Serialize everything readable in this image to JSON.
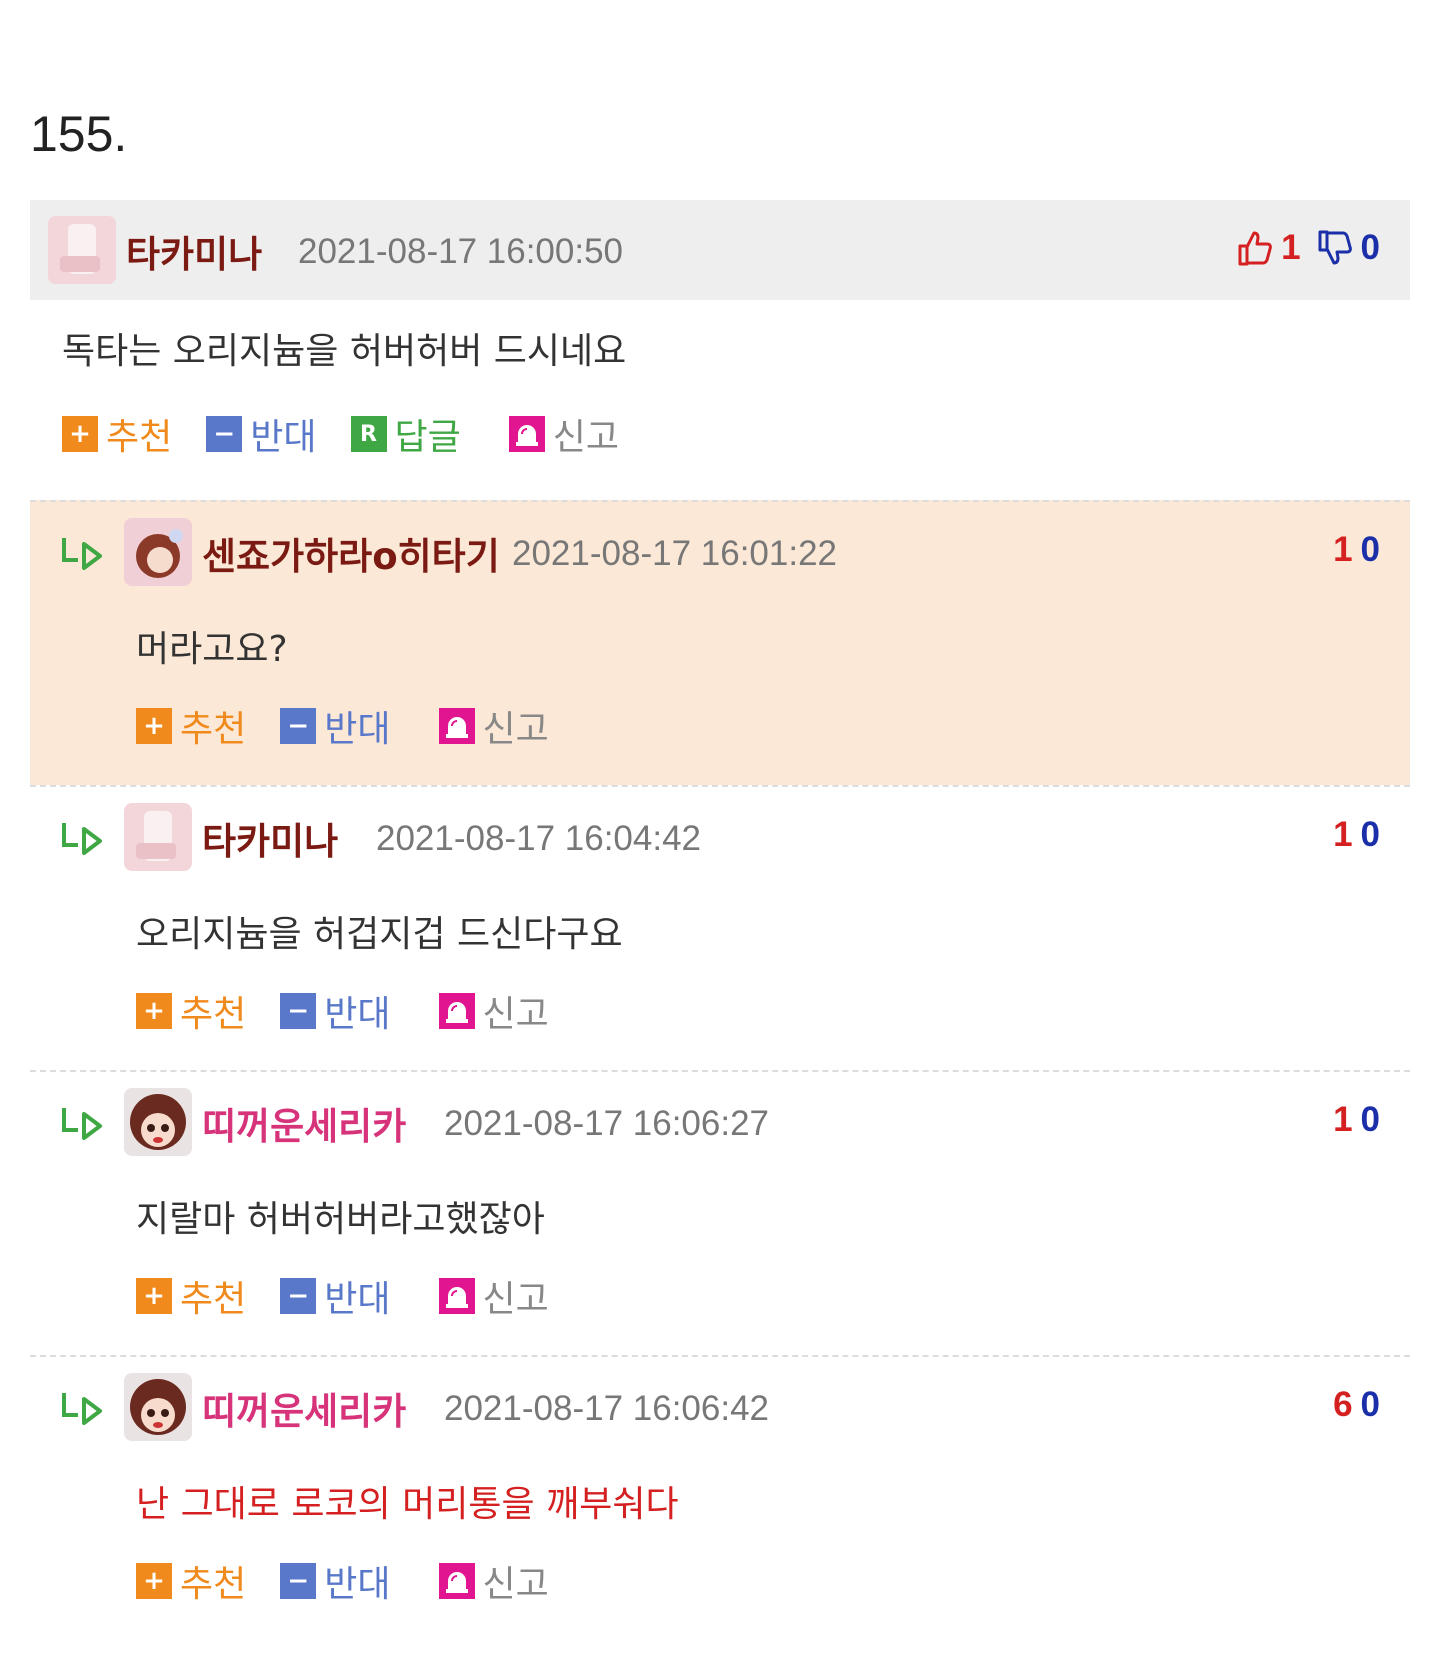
{
  "post_number": "155.",
  "buttons": {
    "recommend": "추천",
    "oppose": "반대",
    "reply": "답글",
    "report": "신고"
  },
  "colors": {
    "up": "#d42020",
    "down": "#1b2fa8",
    "nick_dark": "#7a1a12",
    "nick_pink": "#d6337a",
    "highlight_bg": "#fbe8d6"
  },
  "comments": [
    {
      "nickname": "타카미나",
      "date": "2021-08-17 16:00:50",
      "text": "독타는 오리지늄을 허버허버 드시네요",
      "up": "1",
      "down": "0",
      "avatar": "avatar-icon"
    },
    {
      "nickname": "센죠가하라o히타기",
      "date": "2021-08-17 16:01:22",
      "text": "머라고요?",
      "up": "1",
      "down": "0",
      "avatar": "avatar-icon"
    },
    {
      "nickname": "타카미나",
      "date": "2021-08-17 16:04:42",
      "text": "오리지늄을 허겁지겁 드신다구요",
      "up": "1",
      "down": "0",
      "avatar": "avatar-icon"
    },
    {
      "nickname": "띠꺼운세리카",
      "date": "2021-08-17 16:06:27",
      "text": "지랄마 허버허버라고했잖아",
      "up": "1",
      "down": "0",
      "avatar": "avatar-icon"
    },
    {
      "nickname": "띠꺼운세리카",
      "date": "2021-08-17 16:06:42",
      "text": "난 그대로 로코의 머리통을 깨부숴다",
      "up": "6",
      "down": "0",
      "avatar": "avatar-icon"
    }
  ]
}
